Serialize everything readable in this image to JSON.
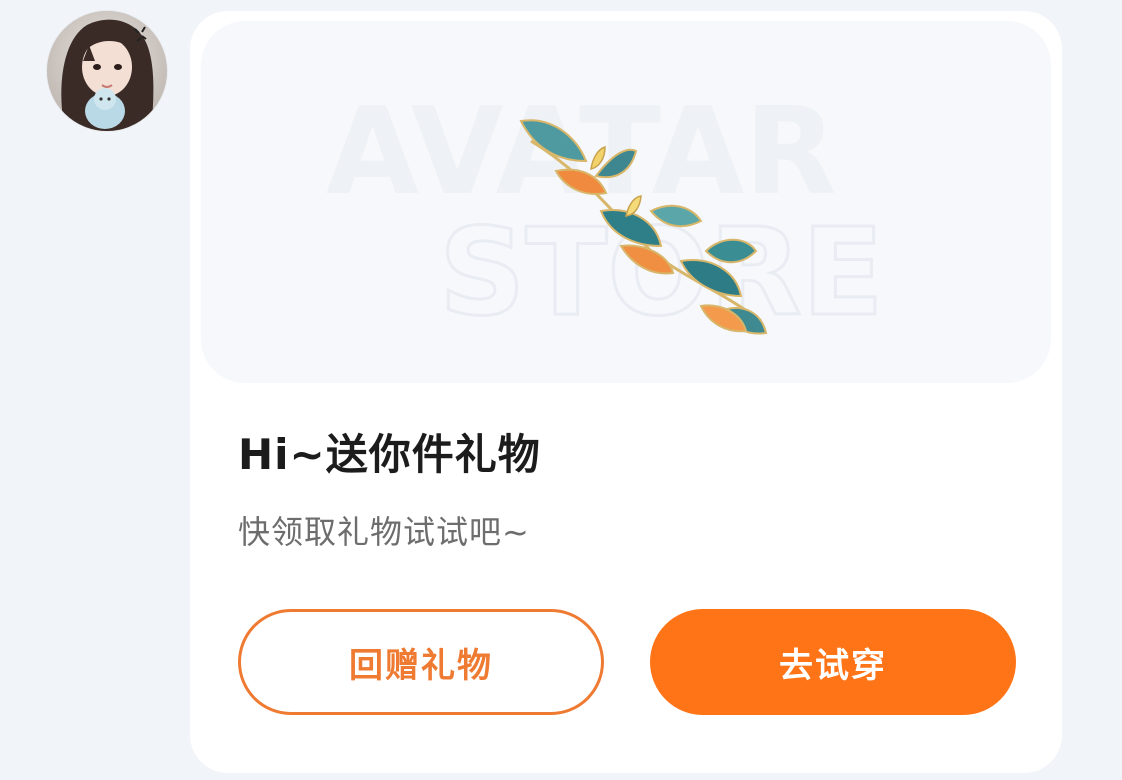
{
  "user": {
    "avatar_icon": "user-avatar"
  },
  "card": {
    "banner_watermark_top": "AVATAR",
    "banner_watermark_bottom": "STORE",
    "banner_item_icon": "leaf-vine-decoration-icon",
    "title": "Hi~送你件礼物",
    "subtitle": "快领取礼物试试吧~",
    "return_gift_label": "回赠礼物",
    "try_on_label": "去试穿"
  },
  "colors": {
    "accent": "#ff7417",
    "accent_outline": "#ef7a31",
    "title_text": "#1c1c1c",
    "subtitle_text": "#6d6d6d",
    "card_bg": "#ffffff",
    "page_bg": "#f1f4f8"
  }
}
